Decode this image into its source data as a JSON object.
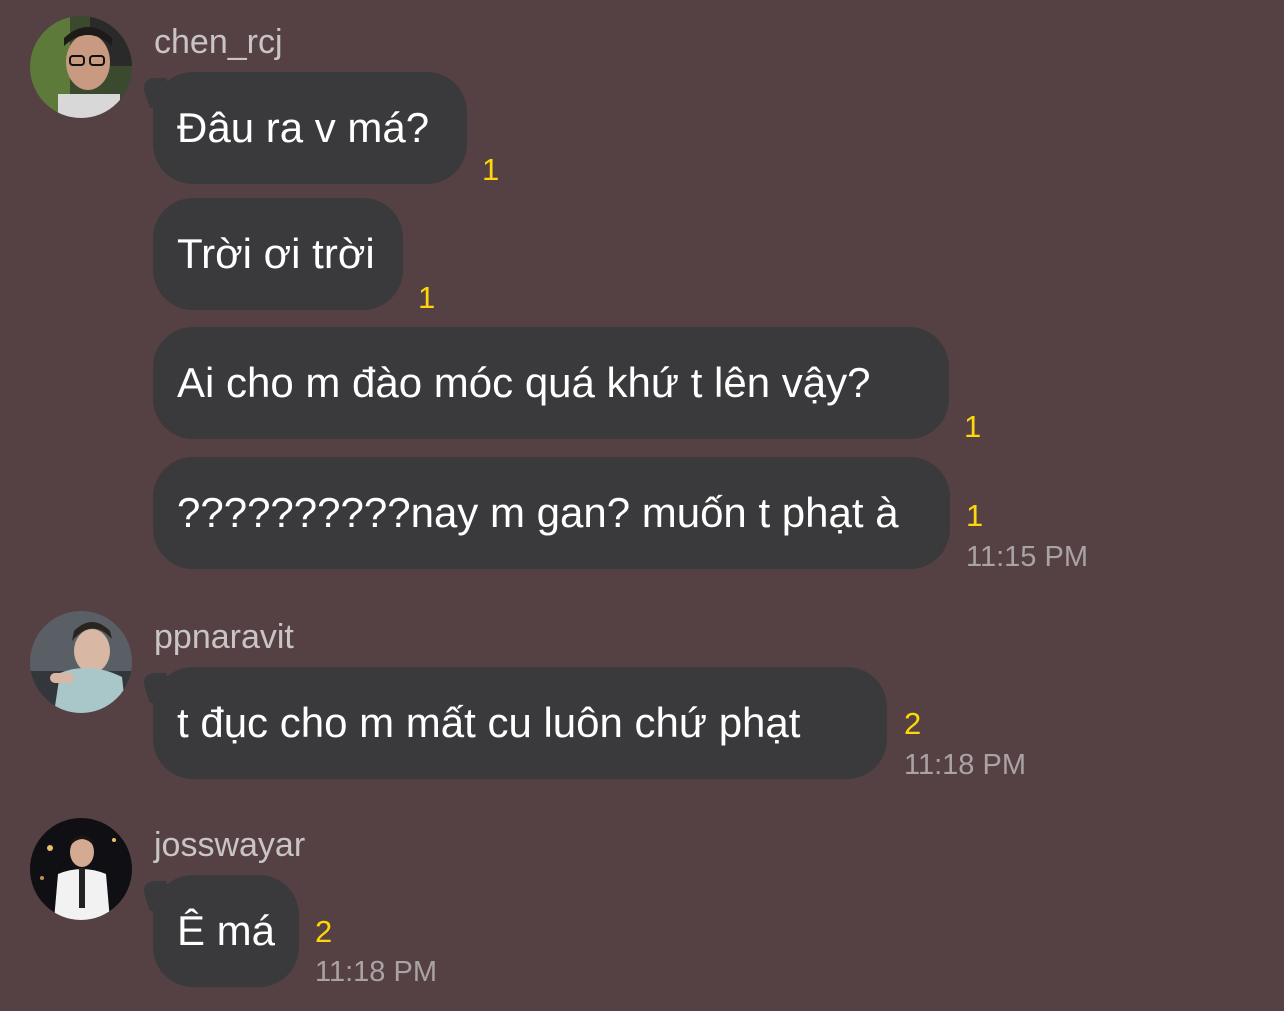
{
  "messages": [
    {
      "username": "chen_rcj",
      "bubbles": [
        {
          "text": "Đâu ra v má?",
          "unread": "1"
        },
        {
          "text": "Trời ơi trời",
          "unread": "1"
        },
        {
          "text": "Ai cho m đào móc quá khứ t lên vậy?",
          "unread": "1"
        },
        {
          "text": "??????????nay m gan? muốn t phạt à",
          "unread": "1"
        }
      ],
      "time": "11:15 PM"
    },
    {
      "username": "ppnaravit",
      "bubbles": [
        {
          "text": "t đục cho m mất cu luôn chứ phạt",
          "unread": "2"
        }
      ],
      "time": "11:18 PM"
    },
    {
      "username": "josswayar",
      "bubbles": [
        {
          "text": "Ê má",
          "unread": "2"
        }
      ],
      "time": "11:18 PM"
    }
  ],
  "colors": {
    "background": "#554143",
    "bubble": "#3a3a3c",
    "unread": "#ffd60a",
    "username": "#c9c4c5",
    "time": "#a9a3a4"
  }
}
